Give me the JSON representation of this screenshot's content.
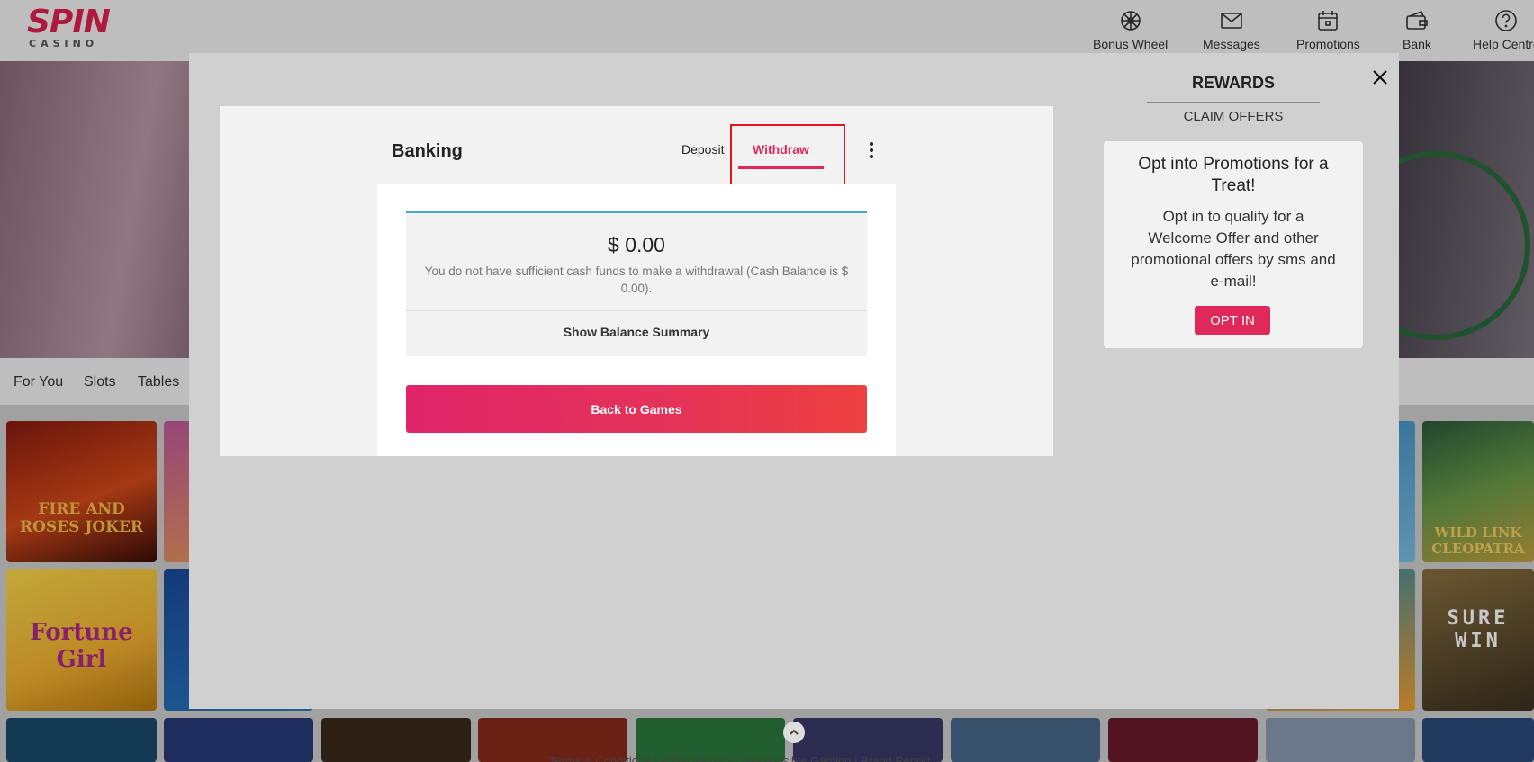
{
  "logo": {
    "brand": "SPIN",
    "sub": "CASINO"
  },
  "header_nav": [
    {
      "label": "Bonus Wheel",
      "icon": "wheel-icon"
    },
    {
      "label": "Messages",
      "icon": "envelope-icon"
    },
    {
      "label": "Promotions",
      "icon": "calendar-icon"
    },
    {
      "label": "Bank",
      "icon": "wallet-icon"
    },
    {
      "label": "Help Centre",
      "icon": "question-icon"
    }
  ],
  "categories": [
    "For You",
    "Slots",
    "Tables"
  ],
  "game_tiles": [
    {
      "title": "FIRE AND ROSES JOKER"
    },
    {
      "title": "Fortune Girl"
    },
    {
      "title": "WILD LINK CLEOPATRA"
    },
    {
      "title": "SURE WIN"
    }
  ],
  "banking": {
    "title": "Banking",
    "tabs": {
      "deposit": "Deposit",
      "withdraw": "Withdraw",
      "active": "Withdraw"
    },
    "balance_amount": "$ 0.00",
    "balance_message": "You do not have sufficient cash funds to make a withdrawal (Cash Balance is $ 0.00).",
    "show_summary_label": "Show Balance Summary",
    "back_button_label": "Back to Games"
  },
  "rewards": {
    "title": "REWARDS",
    "tab": "CLAIM OFFERS",
    "promo_title": "Opt into Promotions for a Treat!",
    "promo_text": "Opt in to qualify for a Welcome Offer and other promotional offers by sms and e-mail!",
    "opt_in_label": "OPT IN"
  },
  "footer": {
    "text": "Terms & Conditions  |  Privacy Policy  |  Responsible Gaming  |  Brand Report"
  },
  "colors": {
    "accent": "#e0285a",
    "balance_border": "#4aa8c0",
    "highlight": "#e8141c"
  }
}
